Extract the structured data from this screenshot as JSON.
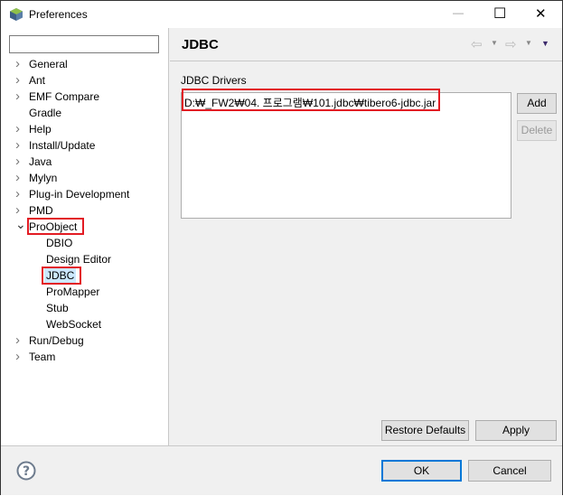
{
  "window": {
    "title": "Preferences",
    "minimize": "—",
    "maximize": "☐",
    "close": "✕"
  },
  "search": {
    "value": "",
    "placeholder": ""
  },
  "tree": [
    {
      "label": "General",
      "expandable": true
    },
    {
      "label": "Ant",
      "expandable": true
    },
    {
      "label": "EMF Compare",
      "expandable": true
    },
    {
      "label": "Gradle",
      "expandable": false
    },
    {
      "label": "Help",
      "expandable": true
    },
    {
      "label": "Install/Update",
      "expandable": true
    },
    {
      "label": "Java",
      "expandable": true
    },
    {
      "label": "Mylyn",
      "expandable": true
    },
    {
      "label": "Plug-in Development",
      "expandable": true
    },
    {
      "label": "PMD",
      "expandable": true
    },
    {
      "label": "ProObject",
      "expandable": true,
      "expanded": true,
      "highlighted": true
    },
    {
      "label": "DBIO",
      "child": true
    },
    {
      "label": "Design Editor",
      "child": true
    },
    {
      "label": "JDBC",
      "child": true,
      "selected": true,
      "highlighted": true
    },
    {
      "label": "ProMapper",
      "child": true
    },
    {
      "label": "Stub",
      "child": true
    },
    {
      "label": "WebSocket",
      "child": true
    },
    {
      "label": "Run/Debug",
      "expandable": true
    },
    {
      "label": "Team",
      "expandable": true
    }
  ],
  "page": {
    "title": "JDBC",
    "drivers_label": "JDBC Drivers",
    "drivers": [
      "D:₩_FW2₩04. 프로그램₩101.jdbc₩tibero6-jdbc.jar"
    ],
    "add": "Add",
    "delete": "Delete",
    "restore_defaults": "Restore Defaults",
    "apply": "Apply"
  },
  "footer": {
    "ok": "OK",
    "cancel": "Cancel"
  },
  "colors": {
    "highlight": "#e21b23",
    "ok_border": "#0078d7",
    "selected_bg": "#cce8ff"
  }
}
